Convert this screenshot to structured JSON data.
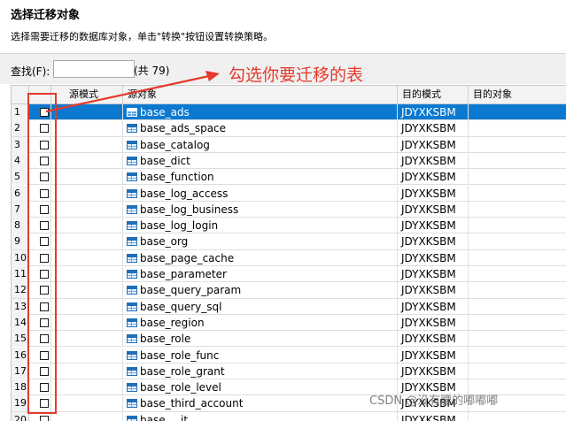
{
  "header": {
    "title": "选择迁移对象",
    "description": "选择需要迁移的数据库对象，单击\"转换\"按钮设置转换策略。"
  },
  "search": {
    "label": "查找(F):",
    "value": "",
    "count": "(共 79)"
  },
  "annotation": {
    "text": "勾选你要迁移的表",
    "color": "#e53a2c"
  },
  "table": {
    "columns": {
      "source_schema": "源模式",
      "source_object": "源对象",
      "target_schema": "目的模式",
      "target_object": "目的对象"
    },
    "rows": [
      {
        "num": "1",
        "object": "base_ads",
        "target_schema": "JDYXKSBM",
        "target_object": "",
        "selected": true
      },
      {
        "num": "2",
        "object": "base_ads_space",
        "target_schema": "JDYXKSBM",
        "target_object": ""
      },
      {
        "num": "3",
        "object": "base_catalog",
        "target_schema": "JDYXKSBM",
        "target_object": ""
      },
      {
        "num": "4",
        "object": "base_dict",
        "target_schema": "JDYXKSBM",
        "target_object": ""
      },
      {
        "num": "5",
        "object": "base_function",
        "target_schema": "JDYXKSBM",
        "target_object": ""
      },
      {
        "num": "6",
        "object": "base_log_access",
        "target_schema": "JDYXKSBM",
        "target_object": ""
      },
      {
        "num": "7",
        "object": "base_log_business",
        "target_schema": "JDYXKSBM",
        "target_object": ""
      },
      {
        "num": "8",
        "object": "base_log_login",
        "target_schema": "JDYXKSBM",
        "target_object": ""
      },
      {
        "num": "9",
        "object": "base_org",
        "target_schema": "JDYXKSBM",
        "target_object": ""
      },
      {
        "num": "10",
        "object": "base_page_cache",
        "target_schema": "JDYXKSBM",
        "target_object": ""
      },
      {
        "num": "11",
        "object": "base_parameter",
        "target_schema": "JDYXKSBM",
        "target_object": ""
      },
      {
        "num": "12",
        "object": "base_query_param",
        "target_schema": "JDYXKSBM",
        "target_object": ""
      },
      {
        "num": "13",
        "object": "base_query_sql",
        "target_schema": "JDYXKSBM",
        "target_object": ""
      },
      {
        "num": "14",
        "object": "base_region",
        "target_schema": "JDYXKSBM",
        "target_object": ""
      },
      {
        "num": "15",
        "object": "base_role",
        "target_schema": "JDYXKSBM",
        "target_object": ""
      },
      {
        "num": "16",
        "object": "base_role_func",
        "target_schema": "JDYXKSBM",
        "target_object": ""
      },
      {
        "num": "17",
        "object": "base_role_grant",
        "target_schema": "JDYXKSBM",
        "target_object": ""
      },
      {
        "num": "18",
        "object": "base_role_level",
        "target_schema": "JDYXKSBM",
        "target_object": ""
      },
      {
        "num": "19",
        "object": "base_third_account",
        "target_schema": "JDYXKSBM",
        "target_object": ""
      },
      {
        "num": "20",
        "object": "base_...it",
        "target_schema": "JDYXKSBM",
        "target_object": ""
      }
    ]
  },
  "watermark": "CSDN @没有腰的嘟嘟嘟",
  "colors": {
    "selection": "#0b79d0",
    "annotation": "#e53a2c"
  }
}
